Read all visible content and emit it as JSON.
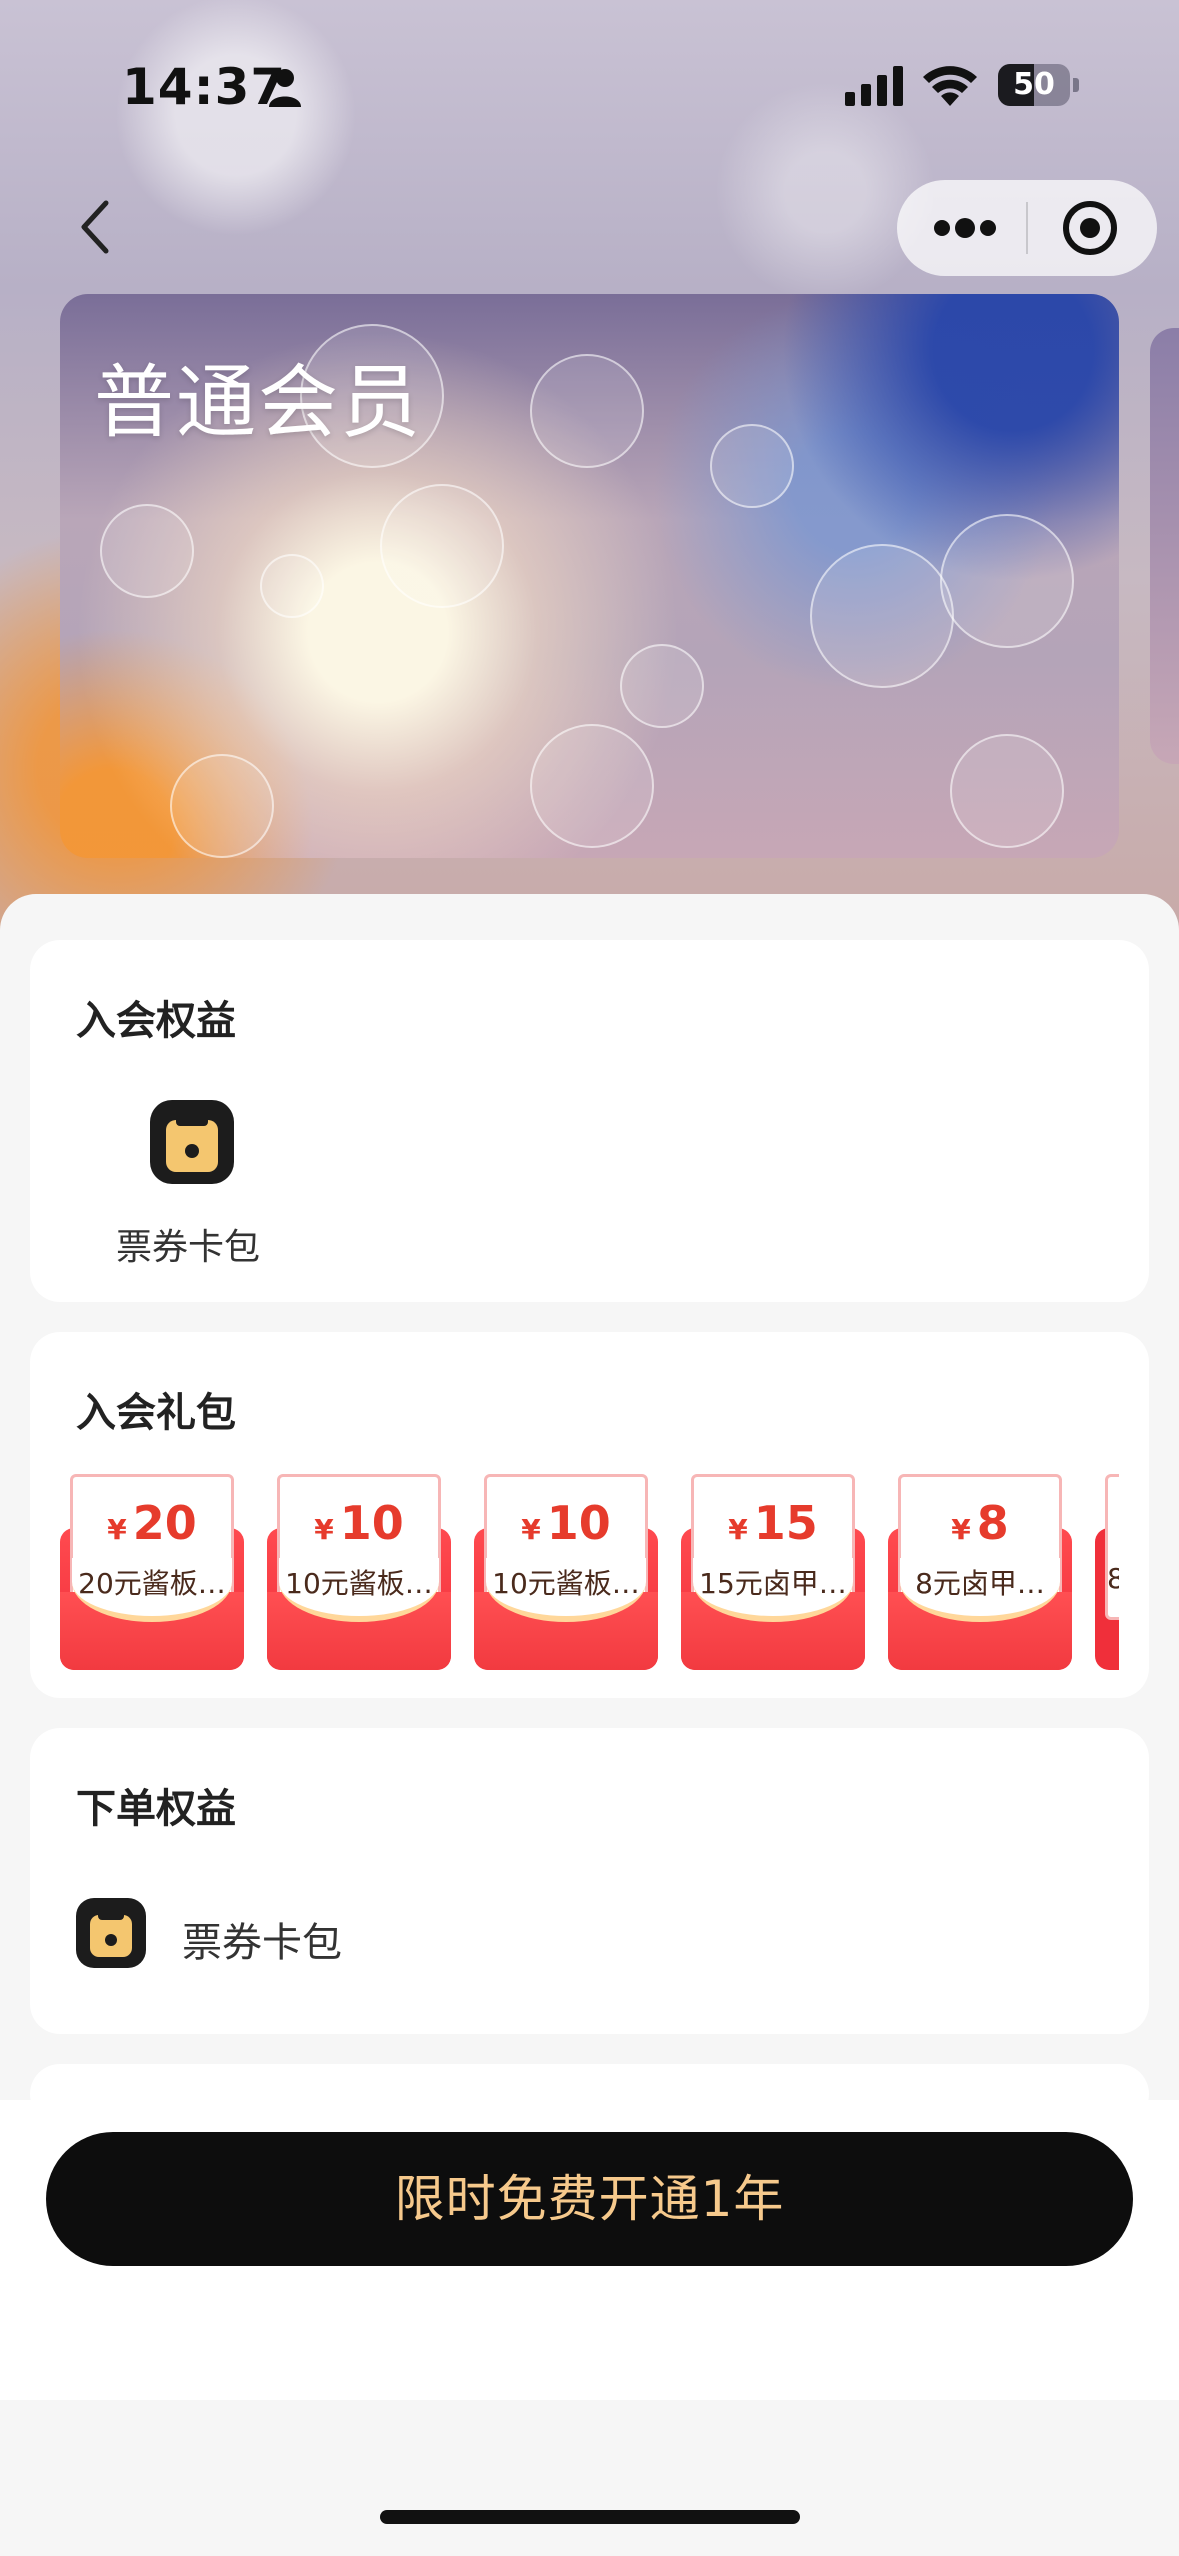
{
  "status_bar": {
    "time": "14:37",
    "battery_level": "50",
    "battery_fraction": 0.5
  },
  "nav": {
    "icons": [
      "back-arrow-icon",
      "more-dots-icon",
      "close-target-icon"
    ]
  },
  "card": {
    "title": "普通会员"
  },
  "join_benefits": {
    "title": "入会权益",
    "items": [
      {
        "label": "票券卡包",
        "icon": "ticket-wallet-icon"
      }
    ]
  },
  "join_gift": {
    "title": "入会礼包",
    "currency": "¥",
    "coupons": [
      {
        "amount": "20",
        "desc": "20元酱板…"
      },
      {
        "amount": "10",
        "desc": "10元酱板…"
      },
      {
        "amount": "10",
        "desc": "10元酱板…"
      },
      {
        "amount": "15",
        "desc": "15元卤甲…"
      },
      {
        "amount": "8",
        "desc": "8元卤甲…"
      }
    ],
    "partial_coupon_text": "8"
  },
  "order_benefits": {
    "title": "下单权益",
    "items": [
      {
        "label": "票券卡包",
        "icon": "ticket-wallet-icon"
      }
    ]
  },
  "cta": {
    "label": "限时免费开通1年"
  },
  "colors": {
    "cta_background": "#0d0d0d",
    "cta_text": "#f6c98c",
    "coupon_red": "#f02f3a",
    "coupon_price": "#e63b2c",
    "icon_gold": "#f4c66f"
  }
}
